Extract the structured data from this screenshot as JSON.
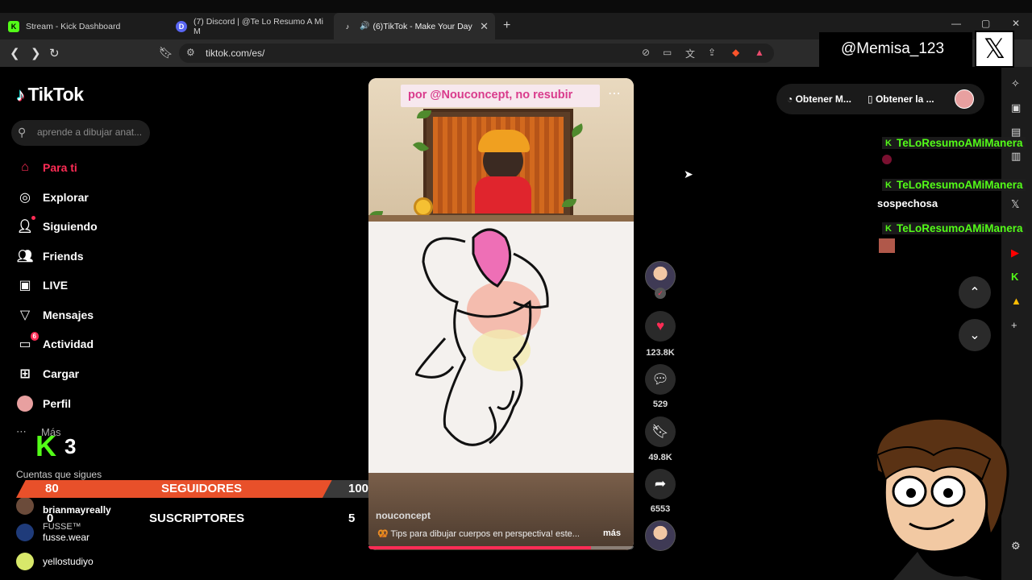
{
  "browser": {
    "tabs": [
      {
        "title": "Stream - Kick Dashboard",
        "favicon": "K"
      },
      {
        "title": "(7) Discord | @Te Lo Resumo A Mi M",
        "favicon": "D"
      },
      {
        "title": "(6)TikTok - Make Your Day",
        "favicon": "♪",
        "active": true
      }
    ],
    "url": "tiktok.com/es/"
  },
  "tiktok": {
    "logo": "TikTok",
    "search_placeholder": "aprende a dibujar anat...",
    "nav": [
      {
        "label": "Para ti",
        "icon": "home-icon",
        "active": true
      },
      {
        "label": "Explorar",
        "icon": "compass-icon"
      },
      {
        "label": "Siguiendo",
        "icon": "following-icon"
      },
      {
        "label": "Friends",
        "icon": "friends-icon"
      },
      {
        "label": "LIVE",
        "icon": "live-icon"
      },
      {
        "label": "Mensajes",
        "icon": "messages-icon"
      },
      {
        "label": "Actividad",
        "icon": "activity-icon",
        "badge": "6"
      },
      {
        "label": "Cargar",
        "icon": "upload-icon"
      },
      {
        "label": "Perfil",
        "icon": "profile-icon"
      }
    ],
    "more_label": "Más",
    "following_title": "Cuentas que sigues",
    "following": [
      {
        "name": "brianmayreally",
        "sub": ""
      },
      {
        "name": "FUSSE™",
        "sub": "fusse.wear"
      },
      {
        "name": "yellostudiyo",
        "sub": ""
      }
    ]
  },
  "video": {
    "caption": "por @Nouconcept, no resubir",
    "author": "nouconcept",
    "description": "🥨 Tips para dibujar cuerpos en perspectiva! este...",
    "more": "más",
    "progress": 0.84
  },
  "actions": {
    "likes": "123.8K",
    "comments": "529",
    "saves": "49.8K",
    "shares": "6553"
  },
  "topbar": {
    "item1": "Obtener M...",
    "item2": "Obtener la ..."
  },
  "chat": {
    "username": "TeLoResumoAMiManera",
    "message": "sospechosa"
  },
  "overlay": {
    "handle": "@Memisa_123",
    "kick_count": "3",
    "followers": {
      "current": "80",
      "label": "SEGUIDORES",
      "goal": "100"
    },
    "subscribers": {
      "current": "0",
      "label": "SUSCRIPTORES",
      "goal": "5"
    }
  },
  "colors": {
    "tiktok_red": "#fe2c55",
    "kick_green": "#53fc18",
    "bar_orange": "#e8502a"
  }
}
